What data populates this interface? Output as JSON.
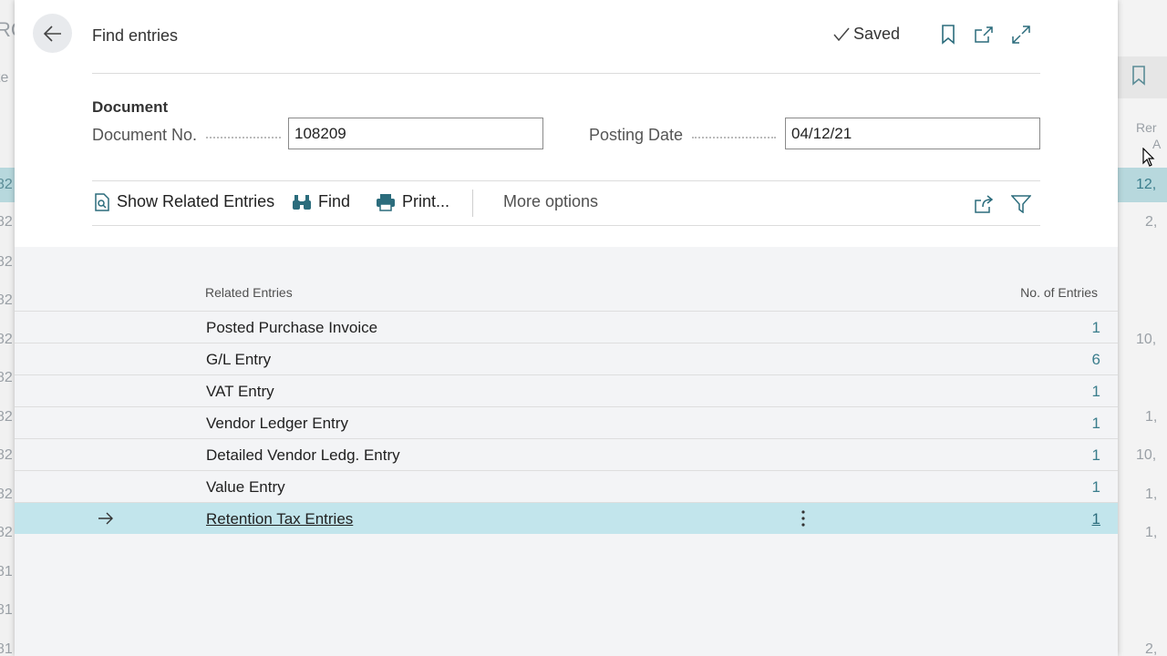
{
  "background": {
    "left_texts": [
      "RC",
      "te",
      ".",
      "82",
      "82",
      "82",
      "82",
      "82",
      "82",
      "82",
      "82",
      "82",
      "82",
      "81",
      "81",
      "81"
    ],
    "right_header": [
      "Rer",
      "A"
    ],
    "right_values": [
      "12,",
      "2,",
      "10,",
      "1,",
      "10,",
      "1,",
      "1,",
      "2,"
    ]
  },
  "header": {
    "title": "Find entries",
    "saved_label": "Saved"
  },
  "document": {
    "section_title": "Document",
    "doc_no_label": "Document No.",
    "doc_no_value": "108209",
    "posting_date_label": "Posting Date",
    "posting_date_value": "04/12/21"
  },
  "actions": {
    "show_related": "Show Related Entries",
    "find": "Find",
    "print": "Print...",
    "more_options": "More options"
  },
  "table": {
    "col_related": "Related Entries",
    "col_count": "No. of Entries",
    "rows": [
      {
        "name": "Posted Purchase Invoice",
        "count": "1"
      },
      {
        "name": "G/L Entry",
        "count": "6"
      },
      {
        "name": "VAT Entry",
        "count": "1"
      },
      {
        "name": "Vendor Ledger Entry",
        "count": "1"
      },
      {
        "name": "Detailed Vendor Ledg. Entry",
        "count": "1"
      },
      {
        "name": "Value Entry",
        "count": "1"
      },
      {
        "name": "Retention Tax Entries",
        "count": "1"
      }
    ],
    "selected_index": 6
  },
  "colors": {
    "accent": "#2b6c7c",
    "selected_row": "#c2e5ec"
  }
}
